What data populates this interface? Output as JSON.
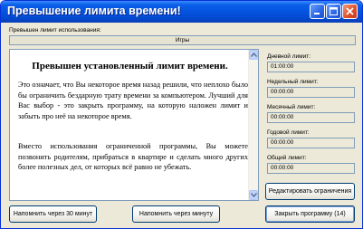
{
  "window": {
    "title": "Превышение лимита времени!"
  },
  "usage": {
    "label": "Превышен лимит использования:",
    "value": "Игры"
  },
  "message": {
    "title": "Превышен установленный лимит времени.",
    "paragraph1": "Это означает, что Вы некоторое время назад решили, что неплохо было бы ограничить бездарную трату времени за компьютером. Лучший для Вас выбор - это закрыть программу, на которую наложен лимит и забыть про неё на некоторое время.",
    "paragraph2": "Вместо использования ограниченной программы, Вы можете позвонить родителям, прибраться в квартире и сделать много других более полезных дел, от которых всё равно не убежать."
  },
  "limits": [
    {
      "label": "Дневной лимит:",
      "value": "01:00:00"
    },
    {
      "label": "Недельный лимит:",
      "value": "00:00:00"
    },
    {
      "label": "Месячный лимит:",
      "value": "00:00:00"
    },
    {
      "label": "Годовой лимит:",
      "value": "00:00:00"
    },
    {
      "label": "Общий лимит:",
      "value": "00:00:00"
    }
  ],
  "buttons": {
    "edit_limits": "Редактировать ограничения",
    "remind_30": "Напомнить через 30 минут",
    "remind_1": "Напомнить через минуту",
    "close_program": "Закрыть программу (14)"
  }
}
